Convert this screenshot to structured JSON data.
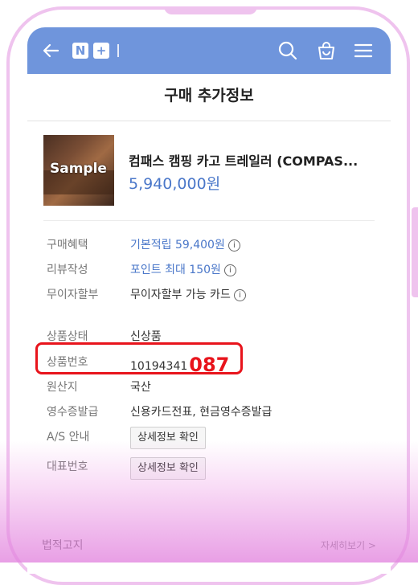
{
  "header": {
    "logo_letter_1": "N",
    "logo_letter_2": "+",
    "back_icon": "back-arrow-icon",
    "search_icon": "search-icon",
    "cart_icon": "shopping-bag-icon",
    "menu_icon": "hamburger-menu-icon",
    "color": "#6f95dc"
  },
  "page": {
    "title": "구매 추가정보"
  },
  "product": {
    "image_label": "Sample",
    "name": "컴패스 캠핑 카고 트레일러 (COMPAS...",
    "price": "5,940,000원"
  },
  "benefits": [
    {
      "label": "구매혜택",
      "value": "기본적립 59,400원",
      "info": "i"
    },
    {
      "label": "리뷰작성",
      "value": "포인트 최대 150원",
      "info": "i"
    },
    {
      "label": "무이자할부",
      "value": "무이자할부 가능 카드",
      "info": "i"
    }
  ],
  "details": {
    "condition": {
      "label": "상품상태",
      "value": "신상품"
    },
    "product_number": {
      "label": "상품번호",
      "value_prefix": "10194341",
      "value_highlight": "087"
    },
    "origin": {
      "label": "원산지",
      "value": "국산"
    },
    "receipt": {
      "label": "영수증발급",
      "value": "신용카드전표, 현금영수증발급"
    },
    "as_info": {
      "label": "A/S 안내",
      "button": "상세정보 확인"
    },
    "rep_number": {
      "label": "대표번호",
      "button": "상세정보 확인"
    }
  },
  "notice": {
    "label": "법적고지",
    "more": "자세히보기 >"
  },
  "colors": {
    "accent": "#4a77c9",
    "highlight": "#e8141c",
    "frame": "#efc3ee"
  }
}
